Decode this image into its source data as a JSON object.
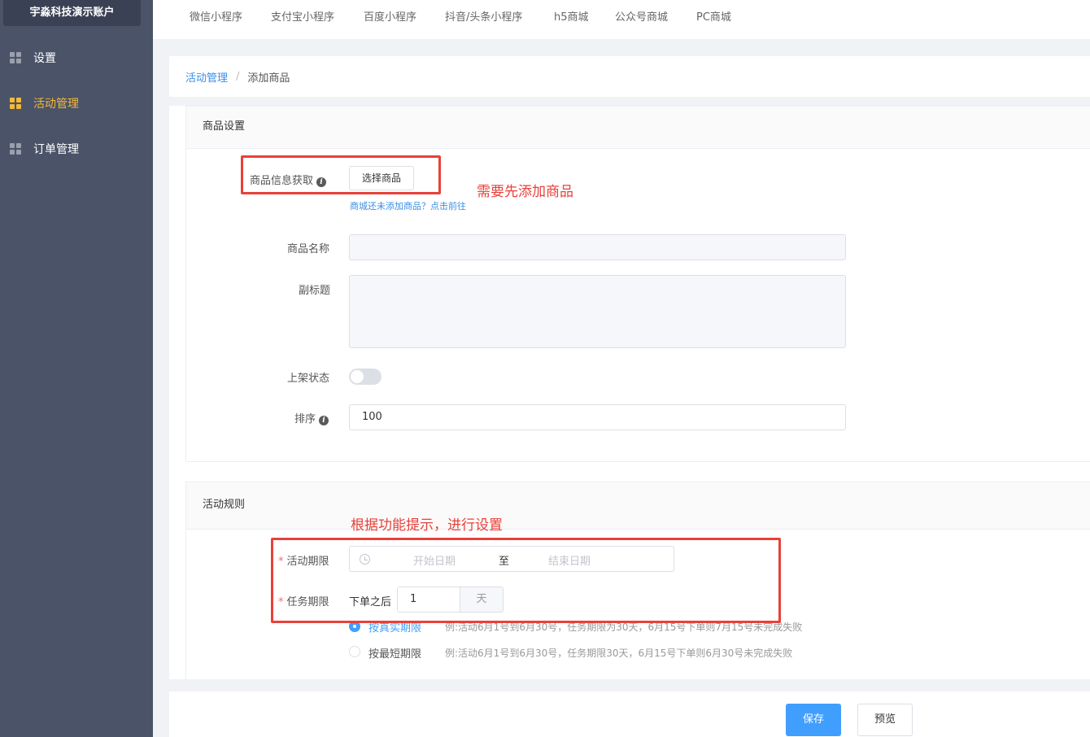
{
  "sidebar": {
    "account": "宇淼科技演示账户",
    "items": [
      {
        "label": "设置",
        "icon": "grid-icon",
        "active": false
      },
      {
        "label": "活动管理",
        "icon": "grid-icon",
        "active": true
      },
      {
        "label": "订单管理",
        "icon": "grid-icon",
        "active": false
      }
    ]
  },
  "tabs": [
    "微信小程序",
    "支付宝小程序",
    "百度小程序",
    "抖音/头条小程序",
    "h5商城",
    "公众号商城",
    "PC商城"
  ],
  "breadcrumb": {
    "parent": "活动管理",
    "separator": "/",
    "current": "添加商品"
  },
  "goods": {
    "title": "商品设置",
    "info_label": "商品信息获取",
    "select_button": "选择商品",
    "tip_link": "商城还未添加商品？点击前往",
    "name_label": "商品名称",
    "name_value": "",
    "subtitle_label": "副标题",
    "subtitle_value": "",
    "status_label": "上架状态",
    "status_on": false,
    "sort_label": "排序",
    "sort_value": "100"
  },
  "rules": {
    "title": "活动规则",
    "period_label": "活动期限",
    "start_placeholder": "开始日期",
    "range_sep": "至",
    "end_placeholder": "结束日期",
    "task_label": "任务期限",
    "task_prefix": "下单之后",
    "task_value": "1",
    "task_unit": "天",
    "options": [
      {
        "label": "按真实期限",
        "desc": "例:活动6月1号到6月30号，任务期限为30天，6月15号下单则7月15号未完成失败",
        "selected": true
      },
      {
        "label": "按最短期限",
        "desc": "例:活动6月1号到6月30号，任务期限30天，6月15号下单则6月30号未完成失败",
        "selected": false
      }
    ]
  },
  "annotations": {
    "note1": "需要先添加商品",
    "note2": "根据功能提示，进行设置",
    "color": "#e8413a"
  },
  "footer": {
    "save": "保存",
    "preview": "预览"
  },
  "colors": {
    "sidebar": "#4a5368",
    "active": "#f5b935",
    "primary": "#409eff"
  }
}
